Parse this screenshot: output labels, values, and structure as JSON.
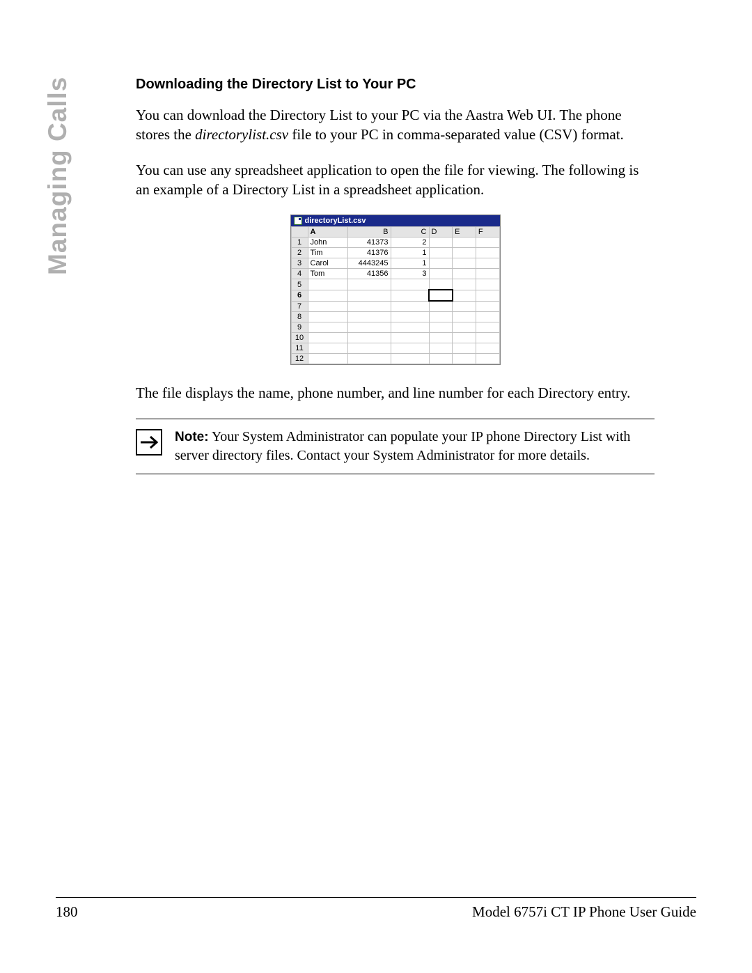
{
  "side_tab": "Managing Calls",
  "heading": "Downloading the Directory List to Your PC",
  "para1_a": "You can download the Directory List to your PC via the Aastra Web UI. The phone stores the ",
  "para1_italic": "directorylist.csv",
  "para1_b": " file to your PC in comma-separated value (CSV) format.",
  "para2": "You can use any spreadsheet application to open the file for viewing. The following is an example of a Directory List in a spreadsheet application.",
  "spreadsheet": {
    "filename": "directoryList.csv",
    "columns": [
      "A",
      "B",
      "C",
      "D",
      "E",
      "F"
    ],
    "active_column": "A",
    "active_cell": {
      "row": 6,
      "col": "D"
    },
    "row_count": 12,
    "rows": [
      {
        "n": "1",
        "A": "John",
        "B": "41373",
        "C": "2",
        "D": "",
        "E": "",
        "F": ""
      },
      {
        "n": "2",
        "A": "Tim",
        "B": "41376",
        "C": "1",
        "D": "",
        "E": "",
        "F": ""
      },
      {
        "n": "3",
        "A": "Carol",
        "B": "4443245",
        "C": "1",
        "D": "",
        "E": "",
        "F": ""
      },
      {
        "n": "4",
        "A": "Tom",
        "B": "41356",
        "C": "3",
        "D": "",
        "E": "",
        "F": ""
      },
      {
        "n": "5",
        "A": "",
        "B": "",
        "C": "",
        "D": "",
        "E": "",
        "F": ""
      },
      {
        "n": "6",
        "A": "",
        "B": "",
        "C": "",
        "D": "",
        "E": "",
        "F": ""
      },
      {
        "n": "7",
        "A": "",
        "B": "",
        "C": "",
        "D": "",
        "E": "",
        "F": ""
      },
      {
        "n": "8",
        "A": "",
        "B": "",
        "C": "",
        "D": "",
        "E": "",
        "F": ""
      },
      {
        "n": "9",
        "A": "",
        "B": "",
        "C": "",
        "D": "",
        "E": "",
        "F": ""
      },
      {
        "n": "10",
        "A": "",
        "B": "",
        "C": "",
        "D": "",
        "E": "",
        "F": ""
      },
      {
        "n": "11",
        "A": "",
        "B": "",
        "C": "",
        "D": "",
        "E": "",
        "F": ""
      },
      {
        "n": "12",
        "A": "",
        "B": "",
        "C": "",
        "D": "",
        "E": "",
        "F": ""
      }
    ]
  },
  "para3": "The file displays the name, phone number, and line number for each Directory entry.",
  "note": {
    "label": "Note:",
    "text": "  Your System Administrator can populate your IP phone Directory List with server directory files. Contact your System Administrator for more details."
  },
  "footer": {
    "page_number": "180",
    "guide": "Model 6757i CT IP Phone User Guide"
  }
}
